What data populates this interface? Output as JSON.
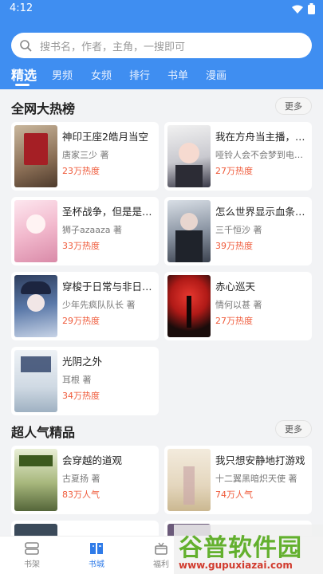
{
  "status_bar": {
    "time": "4:12"
  },
  "search": {
    "placeholder": "搜书名，作者，主角，一搜即可"
  },
  "tabs": [
    {
      "label": "精选",
      "active": true
    },
    {
      "label": "男频"
    },
    {
      "label": "女频"
    },
    {
      "label": "排行"
    },
    {
      "label": "书单"
    },
    {
      "label": "漫画"
    }
  ],
  "sections": [
    {
      "title": "全网大热榜",
      "more_label": "更多",
      "books": [
        {
          "title": "神印王座2皓月当空",
          "author": "唐家三少 著",
          "heat": "23万热度"
        },
        {
          "title": "我在方舟当主播，不...",
          "author": "哑铃人会不会梦到电子歌...",
          "heat": "27万热度"
        },
        {
          "title": "圣杯战争，但是是神...",
          "author": "狮子azaaza 著",
          "heat": "33万热度"
        },
        {
          "title": "怎么世界显示血条了...",
          "author": "三千恒沙 著",
          "heat": "39万热度"
        },
        {
          "title": "穿梭于日常与非日常...",
          "author": "少年先疯队队长 著",
          "heat": "29万热度"
        },
        {
          "title": "赤心巡天",
          "author": "情何以甚 著",
          "heat": "27万热度"
        },
        {
          "title": "光阴之外",
          "author": "耳根 著",
          "heat": "34万热度"
        }
      ]
    },
    {
      "title": "超人气精品",
      "more_label": "更多",
      "books": [
        {
          "title": "会穿越的道观",
          "author": "古夏扬 著",
          "heat": "83万人气"
        },
        {
          "title": "我只想安静地打游戏",
          "author": "十二翼黑暗炽天使 著",
          "heat": "74万人气"
        }
      ]
    }
  ],
  "bottom_nav": [
    {
      "label": "书架",
      "icon": "bookshelf-icon"
    },
    {
      "label": "书城",
      "icon": "bookstore-icon",
      "active": true
    },
    {
      "label": "福利",
      "icon": "gift-icon"
    }
  ],
  "watermark": {
    "text": "谷普软件园",
    "url": "www.gupuxiazai.com"
  },
  "colors": {
    "accent": "#3f8ef1",
    "heat": "#ef5a3a",
    "nav_active": "#2f7be8"
  }
}
